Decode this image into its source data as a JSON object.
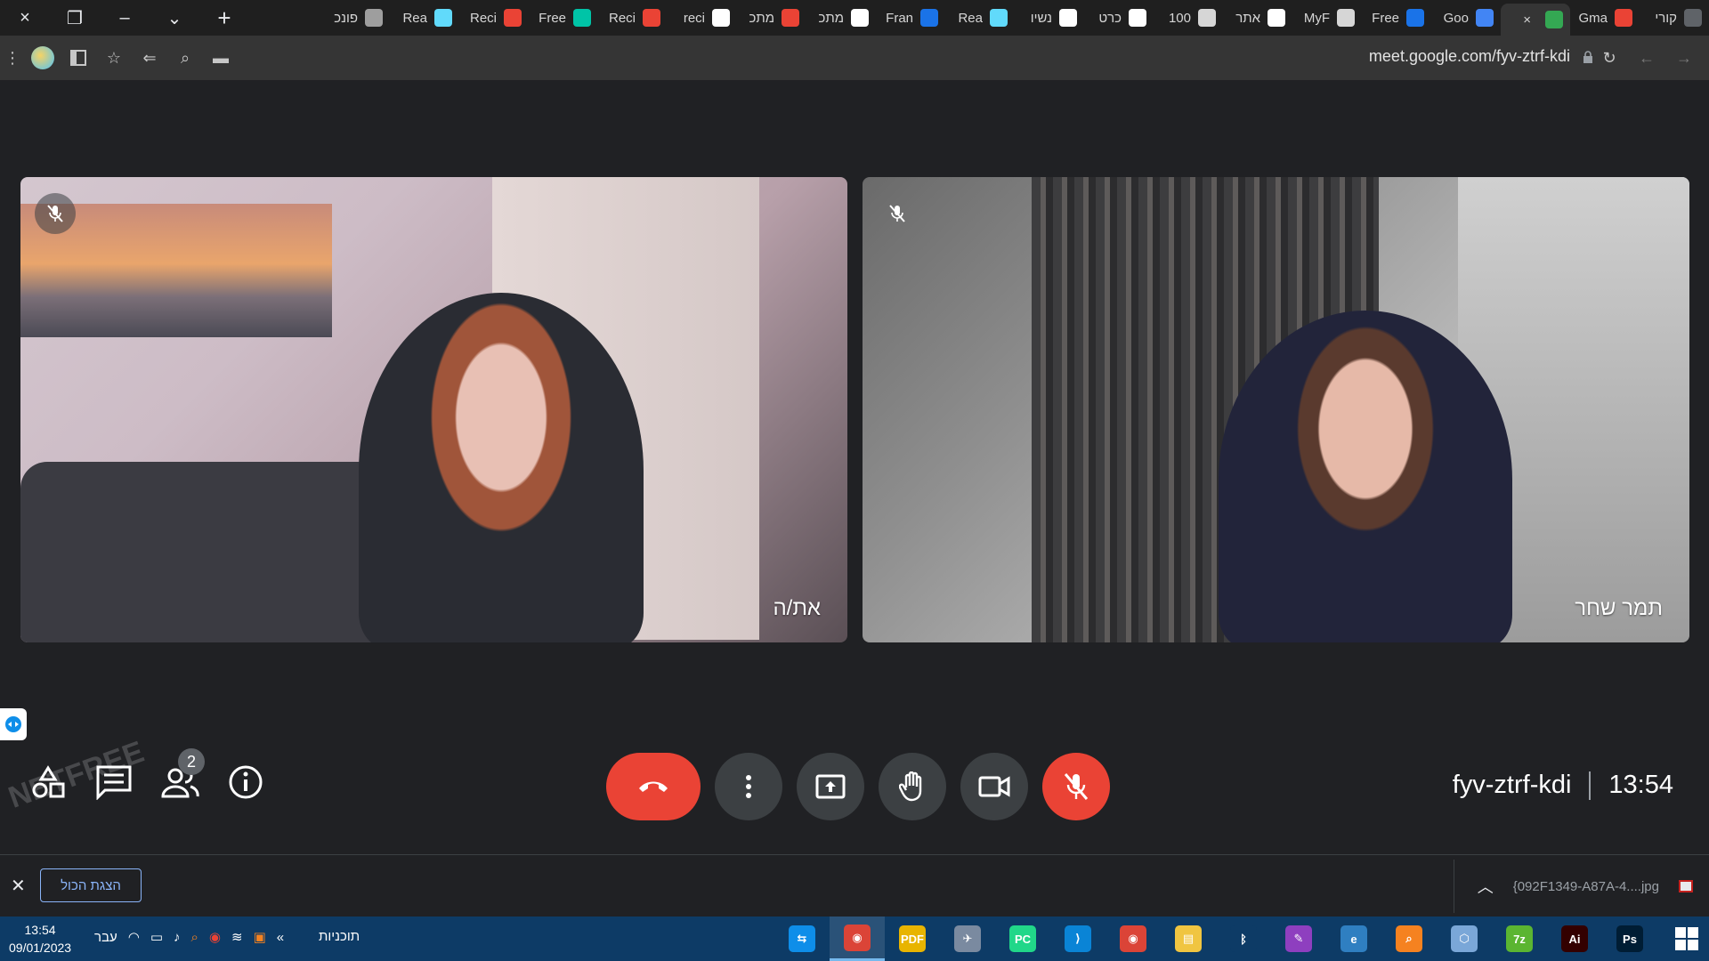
{
  "window": {
    "controls": [
      "×",
      "❐",
      "–",
      "⌄"
    ]
  },
  "tabs": [
    {
      "title": "קורי",
      "favicon_color": "#5f6368",
      "icon": "generic"
    },
    {
      "title": "Gma",
      "favicon_color": "#ea4335",
      "icon": "gmail-icon"
    },
    {
      "title": "",
      "favicon_color": "#34a853",
      "icon": "meet-icon",
      "active": true
    },
    {
      "title": "Goo",
      "favicon_color": "#4285f4",
      "icon": "google-translate-icon"
    },
    {
      "title": "Free",
      "favicon_color": "#1a73e8",
      "icon": "generic"
    },
    {
      "title": "MyF",
      "favicon_color": "#d6d6d6",
      "icon": "generic"
    },
    {
      "title": "אתר",
      "favicon_color": "#ffffff",
      "icon": "google-icon"
    },
    {
      "title": "100",
      "favicon_color": "#d6d6d6",
      "icon": "generic"
    },
    {
      "title": "כרט",
      "favicon_color": "#ffffff",
      "icon": "generic"
    },
    {
      "title": "נשיו",
      "favicon_color": "#ffffff",
      "icon": "generic"
    },
    {
      "title": "Rea",
      "favicon_color": "#61dafb",
      "icon": "react-icon"
    },
    {
      "title": "Fran",
      "favicon_color": "#1a73e8",
      "icon": "generic"
    },
    {
      "title": "מתכ",
      "favicon_color": "#ffffff",
      "icon": "generic"
    },
    {
      "title": "מתכ",
      "favicon_color": "#ea4335",
      "icon": "generic"
    },
    {
      "title": "reci",
      "favicon_color": "#ffffff",
      "icon": "google-icon"
    },
    {
      "title": "Reci",
      "favicon_color": "#ea4335",
      "icon": "generic"
    },
    {
      "title": "Free",
      "favicon_color": "#00c4a7",
      "icon": "generic"
    },
    {
      "title": "Reci",
      "favicon_color": "#ea4335",
      "icon": "generic"
    },
    {
      "title": "Rea",
      "favicon_color": "#61dafb",
      "icon": "react-icon"
    },
    {
      "title": "פונכ",
      "favicon_color": "#9e9e9e",
      "icon": "generic"
    }
  ],
  "new_tab_label": "+",
  "address_bar": {
    "url": "meet.google.com/fyv-ztrf-kdi"
  },
  "participants": [
    {
      "name": "את/ה",
      "muted": true
    },
    {
      "name": "תמר שחר",
      "muted": true
    }
  ],
  "controls": {
    "participants_count": "2",
    "meeting_code": "fyv-ztrf-kdi",
    "time": "13:54"
  },
  "downloads": {
    "show_all": "הצגת הכול",
    "file_name": "{092F1349-A87A-4....jpg"
  },
  "taskbar": {
    "time": "13:54",
    "date": "09/01/2023",
    "language": "עבר",
    "programs_label": "תוכניות",
    "apps": [
      {
        "name": "teamviewer-icon",
        "color": "#0e8ee9",
        "label": "⇆"
      },
      {
        "name": "chrome-icon",
        "color": "#db4437",
        "label": "◉",
        "active": true
      },
      {
        "name": "pdf-icon",
        "color": "#e8b400",
        "label": "PDF"
      },
      {
        "name": "satellite-icon",
        "color": "#7a8aa0",
        "label": "✈"
      },
      {
        "name": "pycharm-icon",
        "color": "#21d789",
        "label": "PC"
      },
      {
        "name": "vscode-icon",
        "color": "#0a84d6",
        "label": "⟩"
      },
      {
        "name": "chrome-icon",
        "color": "#db4437",
        "label": "◉"
      },
      {
        "name": "file-explorer-icon",
        "color": "#f0c541",
        "label": "▤"
      },
      {
        "name": "bluetooth-icon",
        "color": "#0d3b66",
        "label": "ᛒ"
      },
      {
        "name": "paint-icon",
        "color": "#8e3fbf",
        "label": "✎"
      },
      {
        "name": "edge-icon",
        "color": "#2f7fc1",
        "label": "e"
      },
      {
        "name": "search-icon",
        "color": "#f58220",
        "label": "⌕"
      },
      {
        "name": "box-icon",
        "color": "#7aa7d8",
        "label": "⬡"
      },
      {
        "name": "7zip-icon",
        "color": "#5bb531",
        "label": "7z"
      },
      {
        "name": "illustrator-icon",
        "color": "#330000",
        "label": "Ai"
      },
      {
        "name": "photoshop-icon",
        "color": "#001d34",
        "label": "Ps"
      }
    ]
  },
  "colors": {
    "leave_red": "#ea4335",
    "control_grey": "#3c4043",
    "background": "#202124",
    "taskbar": "#0d3b66",
    "link_blue": "#8ab4f8"
  }
}
